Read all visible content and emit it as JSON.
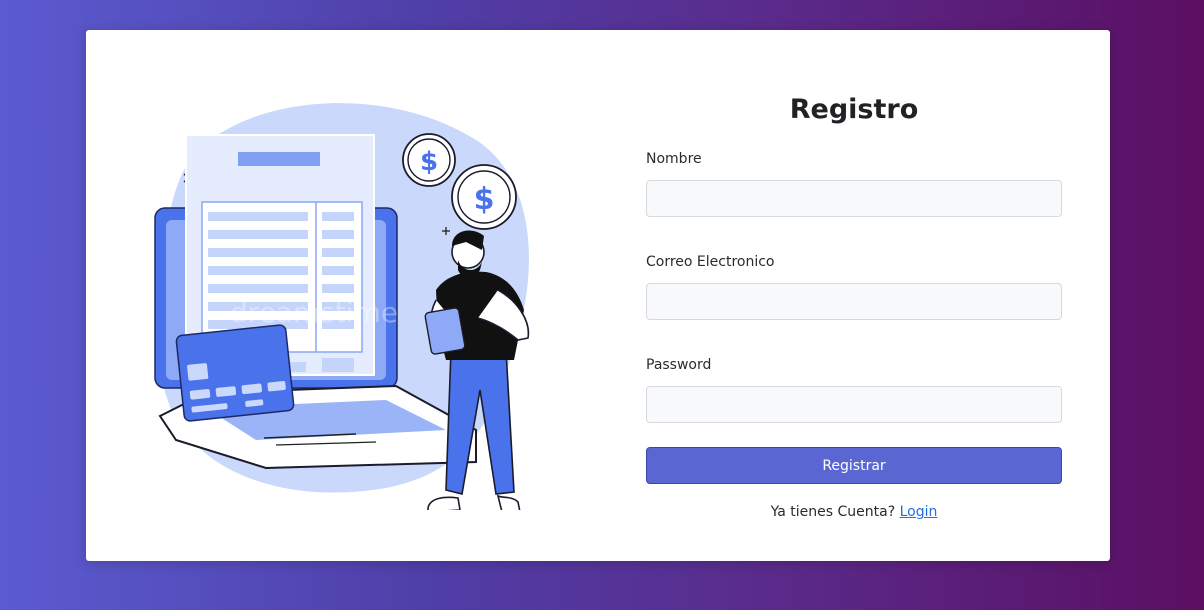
{
  "form": {
    "title": "Registro",
    "fields": [
      {
        "label": "Nombre",
        "value": "",
        "placeholder": ""
      },
      {
        "label": "Correo Electronico",
        "value": "",
        "placeholder": ""
      },
      {
        "label": "Password",
        "value": "",
        "placeholder": ""
      }
    ],
    "submit_label": "Registrar",
    "footer_prompt": "Ya tienes Cuenta?",
    "login_link": "Login"
  },
  "illustration": {
    "icons": [
      "dollar-coin-icon",
      "dollar-coin-icon",
      "credit-card-icon",
      "invoice-icon",
      "laptop-icon",
      "person-icon"
    ],
    "watermark": "dreamstime"
  },
  "colors": {
    "background_start": "#5b5bd0",
    "background_end": "#5b0f63",
    "accent": "#5a67d2",
    "illustration_blue": "#4a72ea",
    "illustration_light": "#c9d8fb",
    "link": "#1f6fe5"
  }
}
